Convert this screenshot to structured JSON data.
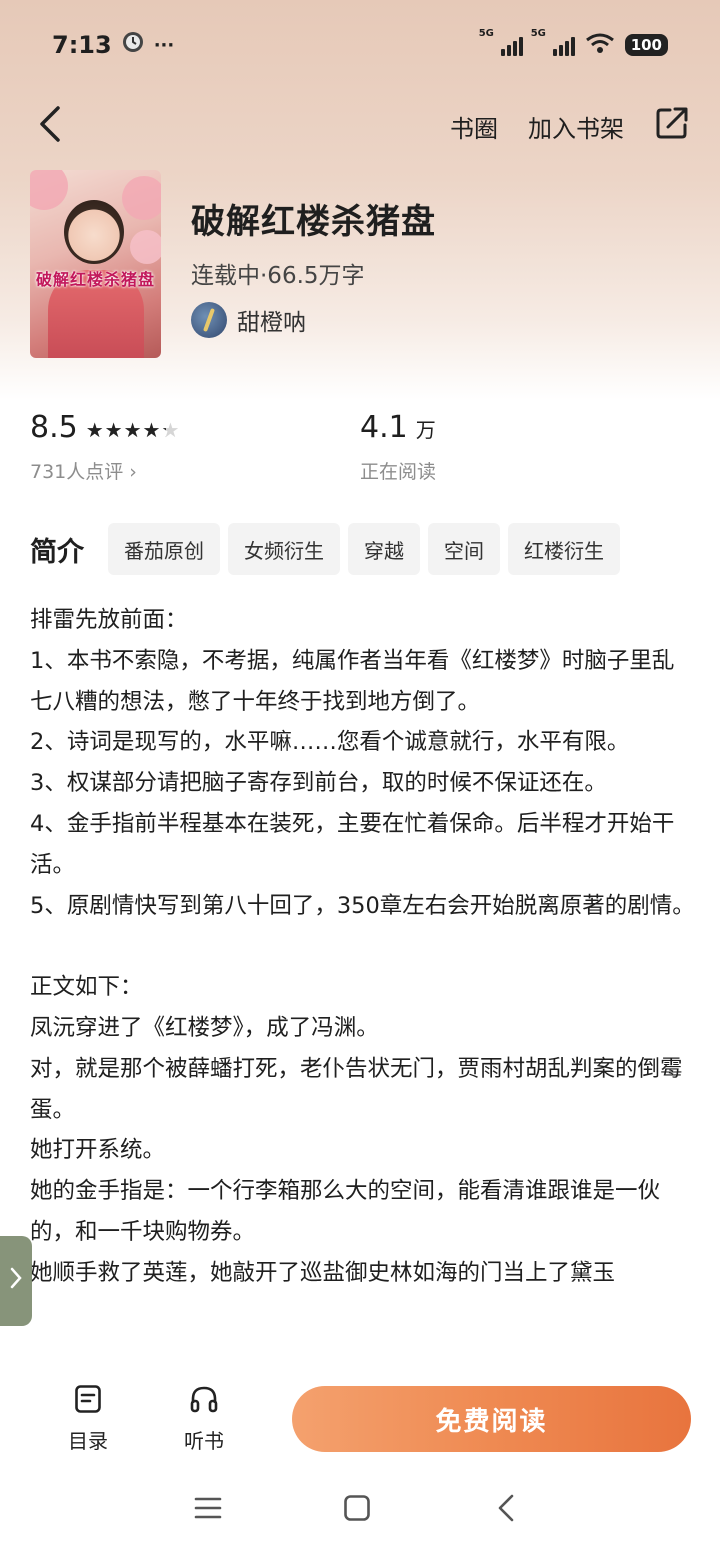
{
  "status_bar": {
    "time": "7:13",
    "more": "···",
    "network1": "5G",
    "network2": "5G",
    "battery": "100"
  },
  "topbar": {
    "circle_label": "书圈",
    "add_shelf_label": "加入书架"
  },
  "book": {
    "cover_title": "破解红楼杀猪盘",
    "title": "破解红楼杀猪盘",
    "meta": "连载中·66.5万字",
    "author": "甜橙呐"
  },
  "stats": {
    "score": "8.5",
    "stars": "★★★★★",
    "rating_fill": 0.85,
    "reviews": "731人点评 ›",
    "readers": "4.1",
    "readers_unit": "万",
    "readers_label": "正在阅读"
  },
  "intro": {
    "heading": "简介",
    "tags": [
      "番茄原创",
      "女频衍生",
      "穿越",
      "空间",
      "红楼衍生"
    ],
    "paragraphs": [
      "排雷先放前面：",
      "1、本书不索隐，不考据，纯属作者当年看《红楼梦》时脑子里乱七八糟的想法，憋了十年终于找到地方倒了。",
      "2、诗词是现写的，水平嘛……您看个诚意就行，水平有限。",
      "3、权谋部分请把脑子寄存到前台，取的时候不保证还在。",
      "4、金手指前半程基本在装死，主要在忙着保命。后半程才开始干活。",
      "5、原剧情快写到第八十回了，350章左右会开始脱离原著的剧情。",
      "",
      "正文如下：",
      "凤沅穿进了《红楼梦》，成了冯渊。",
      "对，就是那个被薛蟠打死，老仆告状无门，贾雨村胡乱判案的倒霉蛋。",
      "她打开系统。",
      "她的金手指是：一个行李箱那么大的空间，能看清谁跟谁是一伙的，和一千块购物券。",
      "她顺手救了英莲，她敲开了巡盐御史林如海的门当上了黛玉"
    ]
  },
  "bottom_bar": {
    "toc_label": "目录",
    "listen_label": "听书",
    "read_label": "免费阅读"
  },
  "colors": {
    "accent": "#ef8a52",
    "hero": "#e6c9b8",
    "tag_bg": "#f3f3f3",
    "side_handle": "#7d8c6f"
  }
}
